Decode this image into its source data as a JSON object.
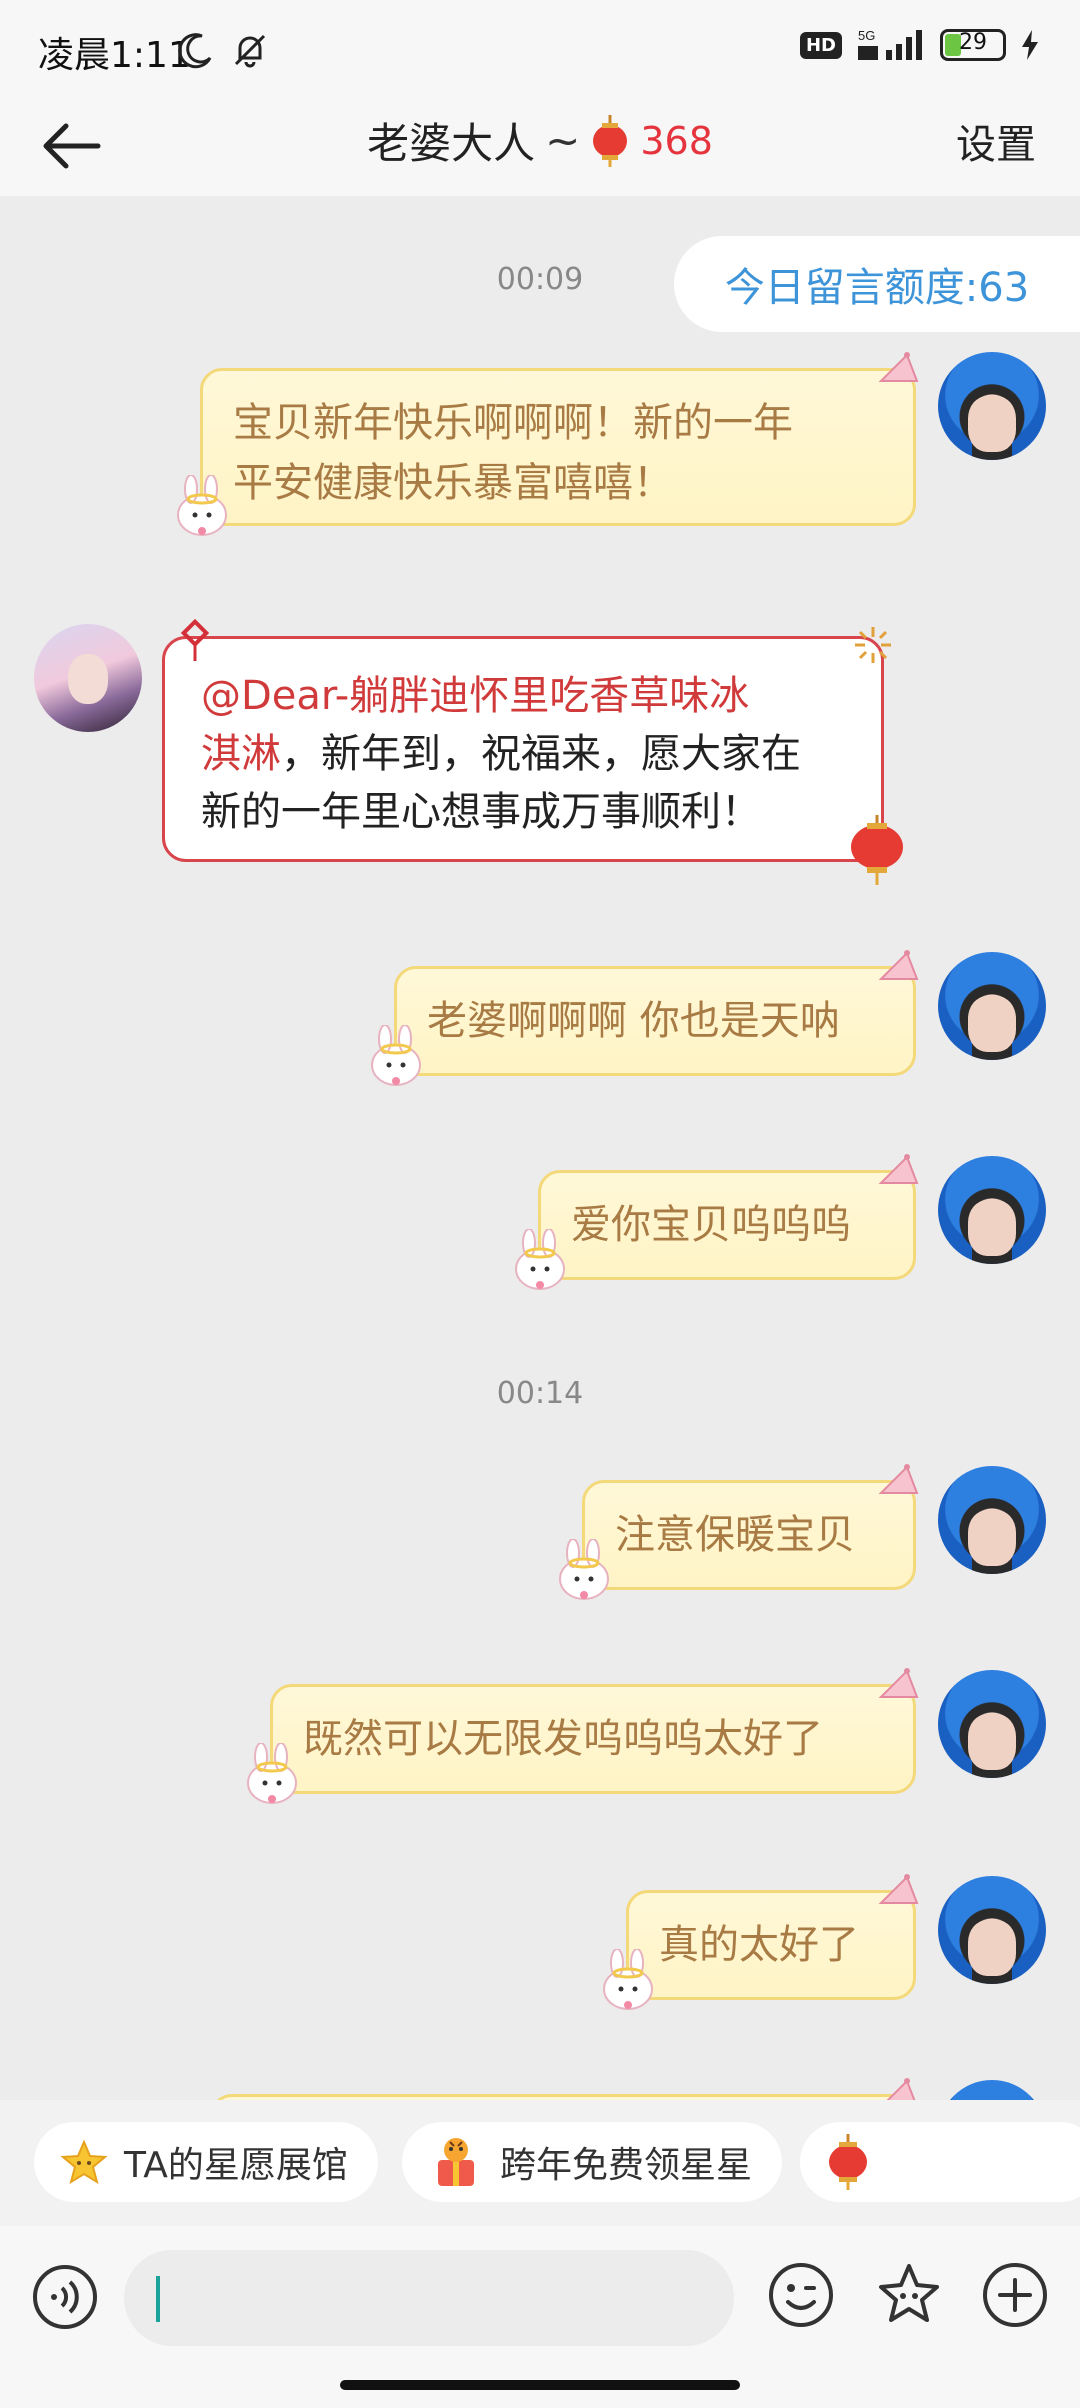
{
  "status_bar": {
    "time": "凌晨1:11",
    "hd_badge": "HD",
    "network": "5G",
    "battery": "29"
  },
  "header": {
    "title": "老婆大人",
    "tilde": "~",
    "intimacy_count": "368",
    "settings_label": "设置"
  },
  "chat": {
    "quota_label": "今日留言额度:63",
    "timestamps": [
      "00:09",
      "00:14"
    ],
    "messages": [
      {
        "sender": "me",
        "lines": [
          "宝贝新年快乐啊啊啊！新的一年",
          "平安健康快乐暴富嘻嘻！"
        ]
      },
      {
        "sender": "other",
        "mention": "@Dear-躺胖迪怀里吃香草味冰",
        "line1_tail": "",
        "line2_mention": "淇淋",
        "line2_rest": "，新年到，祝福来，愿大家在",
        "line3": "新的一年里心想事成万事顺利！"
      },
      {
        "sender": "me",
        "text": "老婆啊啊啊  你也是天呐"
      },
      {
        "sender": "me",
        "text": "爱你宝贝呜呜呜"
      },
      {
        "sender": "me",
        "text": "注意保暖宝贝"
      },
      {
        "sender": "me",
        "text": "既然可以无限发呜呜呜太好了"
      },
      {
        "sender": "me",
        "text": "真的太好了"
      }
    ]
  },
  "quick_actions": [
    {
      "label": "TA的星愿展馆",
      "icon": "star-icon"
    },
    {
      "label": "跨年免费领星星",
      "icon": "tiger-gift-icon"
    },
    {
      "label": "",
      "icon": "lantern-icon"
    }
  ],
  "input": {
    "placeholder": ""
  },
  "colors": {
    "bubble_fill": "#fff6cf",
    "bubble_border": "#f4d97a",
    "bubble_text": "#a87a44",
    "accent_red": "#e5343e",
    "quota_blue": "#3e94d8"
  }
}
